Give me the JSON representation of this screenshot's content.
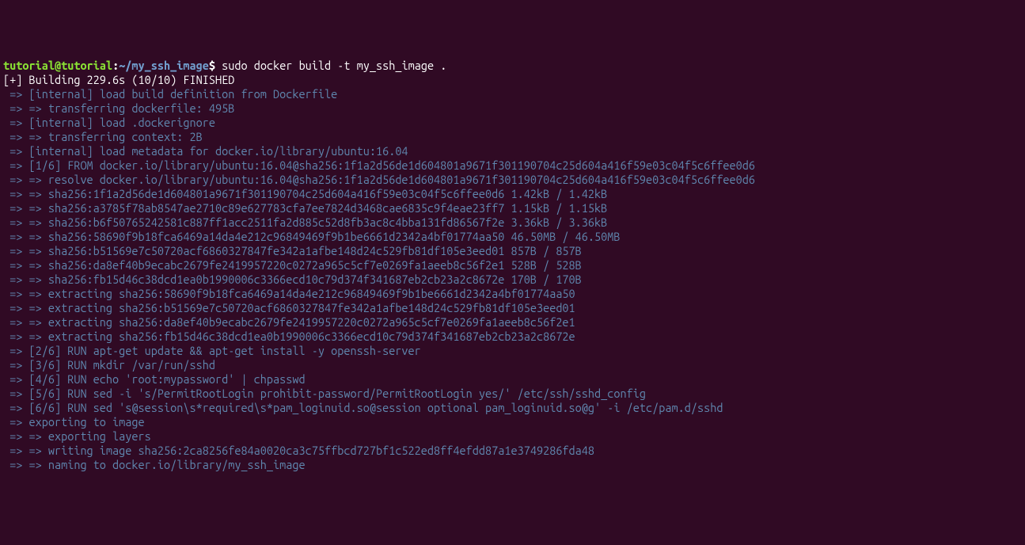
{
  "prompt": {
    "user": "tutorial",
    "at": "@",
    "host": "tutorial",
    "colon": ":",
    "path": "~/my_ssh_image",
    "dollar": "$ ",
    "command": "sudo docker build -t my_ssh_image ."
  },
  "status_line": "[+] Building 229.6s (10/10) FINISHED",
  "lines": [
    "=> [internal] load build definition from Dockerfile",
    "=> => transferring dockerfile: 495B",
    "=> [internal] load .dockerignore",
    "=> => transferring context: 2B",
    "=> [internal] load metadata for docker.io/library/ubuntu:16.04",
    "=> [1/6] FROM docker.io/library/ubuntu:16.04@sha256:1f1a2d56de1d604801a9671f301190704c25d604a416f59e03c04f5c6ffee0d6",
    "=> => resolve docker.io/library/ubuntu:16.04@sha256:1f1a2d56de1d604801a9671f301190704c25d604a416f59e03c04f5c6ffee0d6",
    "=> => sha256:1f1a2d56de1d604801a9671f301190704c25d604a416f59e03c04f5c6ffee0d6 1.42kB / 1.42kB",
    "=> => sha256:a3785f78ab8547ae2710c89e627783cfa7ee7824d3468cae6835c9f4eae23ff7 1.15kB / 1.15kB",
    "=> => sha256:b6f50765242581c887ff1acc2511fa2d885c52d8fb3ac8c4bba131fd86567f2e 3.36kB / 3.36kB",
    "=> => sha256:58690f9b18fca6469a14da4e212c96849469f9b1be6661d2342a4bf01774aa50 46.50MB / 46.50MB",
    "=> => sha256:b51569e7c50720acf6860327847fe342a1afbe148d24c529fb81df105e3eed01 857B / 857B",
    "=> => sha256:da8ef40b9ecabc2679fe2419957220c0272a965c5cf7e0269fa1aeeb8c56f2e1 528B / 528B",
    "=> => sha256:fb15d46c38dcd1ea0b1990006c3366ecd10c79d374f341687eb2cb23a2c8672e 170B / 170B",
    "=> => extracting sha256:58690f9b18fca6469a14da4e212c96849469f9b1be6661d2342a4bf01774aa50",
    "=> => extracting sha256:b51569e7c50720acf6860327847fe342a1afbe148d24c529fb81df105e3eed01",
    "=> => extracting sha256:da8ef40b9ecabc2679fe2419957220c0272a965c5cf7e0269fa1aeeb8c56f2e1",
    "=> => extracting sha256:fb15d46c38dcd1ea0b1990006c3366ecd10c79d374f341687eb2cb23a2c8672e",
    "=> [2/6] RUN apt-get update && apt-get install -y openssh-server",
    "=> [3/6] RUN mkdir /var/run/sshd",
    "=> [4/6] RUN echo 'root:mypassword' | chpasswd",
    "=> [5/6] RUN sed -i 's/PermitRootLogin prohibit-password/PermitRootLogin yes/' /etc/ssh/sshd_config",
    "=> [6/6] RUN sed 's@session\\s*required\\s*pam_loginuid.so@session optional pam_loginuid.so@g' -i /etc/pam.d/sshd",
    "=> exporting to image",
    "=> => exporting layers",
    "=> => writing image sha256:2ca8256fe84a0020ca3c75ffbcd727bf1c522ed8ff4efdd87a1e3749286fda48",
    "=> => naming to docker.io/library/my_ssh_image"
  ]
}
